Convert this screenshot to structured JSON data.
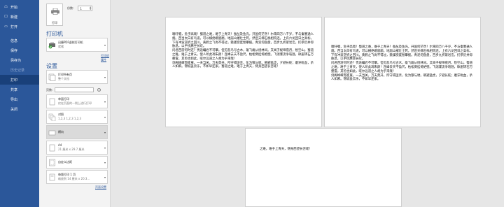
{
  "nav": {
    "items": [
      {
        "icon": "☖",
        "label": "开始"
      },
      {
        "icon": "☐",
        "label": "新建"
      },
      {
        "icon": "▭",
        "label": "打开"
      },
      {
        "icon": "",
        "label": "信息"
      },
      {
        "icon": "",
        "label": "保存"
      },
      {
        "icon": "",
        "label": "另存为"
      },
      {
        "icon": "",
        "label": "历史记录"
      },
      {
        "icon": "",
        "label": "打印"
      },
      {
        "icon": "",
        "label": "共享"
      },
      {
        "icon": "",
        "label": "导出"
      },
      {
        "icon": "",
        "label": "关闭"
      }
    ]
  },
  "print": {
    "button_label": "打印",
    "copies_label": "份数:",
    "copies_value": "1"
  },
  "printer": {
    "heading": "打印机",
    "name": "迅捷PDF虚拟打印机",
    "status": "就绪",
    "props_link": "打印机属性"
  },
  "settings": {
    "heading": "设置",
    "pages_label": "页数:",
    "pages_value": "",
    "info_glyph": "i",
    "page_setup_link": "页面设置",
    "cards": [
      {
        "t1": "打印所有页",
        "t2": "整个文档"
      },
      {
        "t1": "单面打印",
        "t2": "仅在页面的一侧上进行打印"
      },
      {
        "t1": "对照",
        "t2": "1,2,3    1,2,3    1,2,3"
      },
      {
        "t1": "横向",
        "t2": ""
      },
      {
        "t1": "A4",
        "t2": "21 厘米 x 29.7 厘米"
      },
      {
        "t1": "自定义边距",
        "t2": ""
      },
      {
        "t1": "每版打印 1 页",
        "t2": "缩放到 14 厘米 x 20.3..."
      }
    ]
  },
  "preview": {
    "page1_text": "噫吁嚱，危乎高哉！蜀道之难，难于上青天！蚕丛及鱼凫，开国何茫然！尔来四万八千岁，不与秦塞通人烟。西当太白有鸟道，可以横绝峨眉巅。地崩山摧壮士死，然后天梯石栈相钩连。上有六龙回日之高标，下有冲波逆折之回川。黄鹤之飞尚不得过，猿猱欲度愁攀援。青泥何盘盘，百步九折萦岩峦。扪参历井仰胁息，以手抚膺坐长叹。\n问君西游何时还？畏途巉岩不可攀。但见悲鸟号古木，雄飞雌从绕林间。又闻子规啼夜月，愁空山。蜀道之难，难于上青天，使人听此凋朱颜！连峰去天不盈尺，枯松倒挂倚绝壁。飞湍瀑流争喧豗，砯崖转石万壑雷。其险也如此，嗟尔远道之人胡为乎来哉！\n剑阁峥嵘而崔嵬，一夫当关，万夫莫开。所守或匪亲，化为狼与豺。朝避猛虎，夕避长蛇；磨牙吮血，杀人如麻。锦城虽云乐，不如早还家。蜀道之难，难于上青天，侧身西望长咨嗟！",
    "page2_text": "噫吁嚱，危乎高哉！蜀道之难，难于上青天！蚕丛及鱼凫，开国何茫然！尔来四万八千岁，不与秦塞通人烟。西当太白有鸟道，可以横绝峨眉巅。地崩山摧壮士死，然后天梯石栈相钩连。上有六龙回日之高标，下有冲波逆折之回川。黄鹤之飞尚不得过，猿猱欲度愁攀援。青泥何盘盘，百步九折萦岩峦。扪参历井仰胁息，以手抚膺坐长叹。\n问君西游何时还？畏途巉岩不可攀。但见悲鸟号古木，雄飞雌从绕林间。又闻子规啼夜月，愁空山。蜀道之难，难于上青天，使人听此凋朱颜！连峰去天不盈尺，枯松倒挂倚绝壁。飞湍瀑流争喧豗，砯崖转石万壑雷。其险也如此，嗟尔远道之人胡为乎来哉！\n剑阁峥嵘而崔嵬，一夫当关，万夫莫开。所守或匪亲，化为狼与豺。朝避猛虎，夕避长蛇；磨牙吮血，杀人如麻。锦城虽云乐，不如早还家。",
    "page3_text": "之难，难于上青天，侧身西望长咨嗟！"
  }
}
